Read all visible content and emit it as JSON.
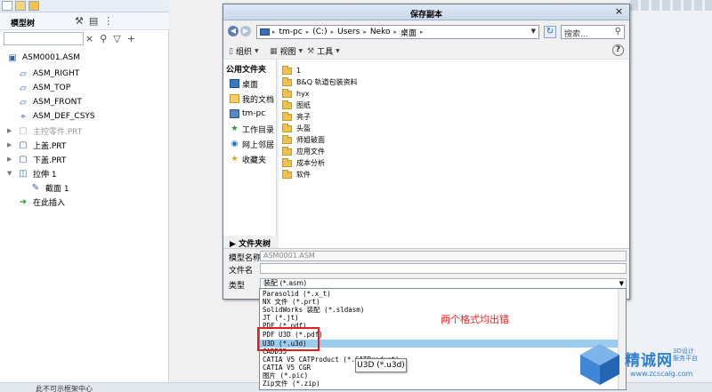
{
  "app": {
    "model_tree_title": "模型树",
    "status_text": "此不可示框架中心",
    "tree": [
      {
        "label": "ASM0001.ASM",
        "icon": "assembly-icon",
        "dim": false
      },
      {
        "label": "ASM_RIGHT",
        "icon": "datum-plane-icon",
        "dim": false
      },
      {
        "label": "ASM_TOP",
        "icon": "datum-plane-icon",
        "dim": false
      },
      {
        "label": "ASM_FRONT",
        "icon": "datum-plane-icon",
        "dim": false
      },
      {
        "label": "ASM_DEF_CSYS",
        "icon": "csys-icon",
        "dim": false
      },
      {
        "label": "主控零件.PRT",
        "icon": "part-icon",
        "dim": true
      },
      {
        "label": "上盖.PRT",
        "icon": "part-icon",
        "dim": false
      },
      {
        "label": "下盖.PRT",
        "icon": "part-icon",
        "dim": false
      },
      {
        "label": "拉伸 1",
        "icon": "extrude-icon",
        "dim": false
      },
      {
        "label": "截面 1",
        "icon": "sketch-icon",
        "dim": false
      },
      {
        "label": "在此插入",
        "icon": "insert-here-icon",
        "dim": false
      }
    ]
  },
  "dialog": {
    "title": "保存副本",
    "close": "×",
    "address": {
      "segments": [
        "tm-pc",
        "(C:)",
        "Users",
        "Neko",
        "桌面"
      ],
      "separator": "▸"
    },
    "search_placeholder": "搜索...",
    "toolbar": {
      "organize": "组织",
      "views": "视图",
      "tools": "工具",
      "help": "?"
    },
    "favorites_heading": "公用文件夹",
    "favorites": [
      {
        "label": "桌面",
        "icon": "desktop-icon"
      },
      {
        "label": "我的文档",
        "icon": "documents-icon"
      },
      {
        "label": "tm-pc",
        "icon": "computer-icon"
      },
      {
        "label": "工作目录",
        "icon": "working-dir-icon"
      },
      {
        "label": "网上邻居",
        "icon": "network-icon"
      },
      {
        "label": "收藏夹",
        "icon": "favorites-icon"
      }
    ],
    "files": [
      "1",
      "B&Q 轨道包装资料",
      "hyx",
      "图纸",
      "亮子",
      "头盔",
      "师姐破面",
      "应用文件",
      "成本分析",
      "软件"
    ],
    "folder_tree": "文件夹树",
    "model_name_label": "模型名称",
    "model_name_value": "ASM0001.ASM",
    "file_name_label": "文件名",
    "file_name_value": "",
    "type_label": "类型",
    "type_value": "装配 (*.asm)"
  },
  "dropdown": {
    "options": [
      "Parasolid (*.x_t)",
      "NX 文件 (*.prt)",
      "SolidWorks 装配 (*.sldasm)",
      "JT (*.jt)",
      "PDF (*.pdf)",
      "PDF U3D (*.pdf)",
      "U3D (*.u3d)",
      "CADDS5",
      "CATIA V5 CATProduct (*.CATProduct)",
      "CATIA V5 CGR",
      "图片 (*.pic)",
      "Zip文件 (*.zip)"
    ],
    "selected_index": 6
  },
  "annotation": "两个格式均出错",
  "tooltip": "U3D (*.u3d)",
  "watermark": {
    "name": "精诚网",
    "sub1": "3D设计",
    "sub2": "服务平台",
    "url": "www.zcscaig.com"
  },
  "colors": {
    "selected_row": "#99ccee",
    "annotation_red": "#ff1e1e",
    "watermark_blue": "#2f7fd4",
    "folder_yellow": "#f0c24d"
  }
}
